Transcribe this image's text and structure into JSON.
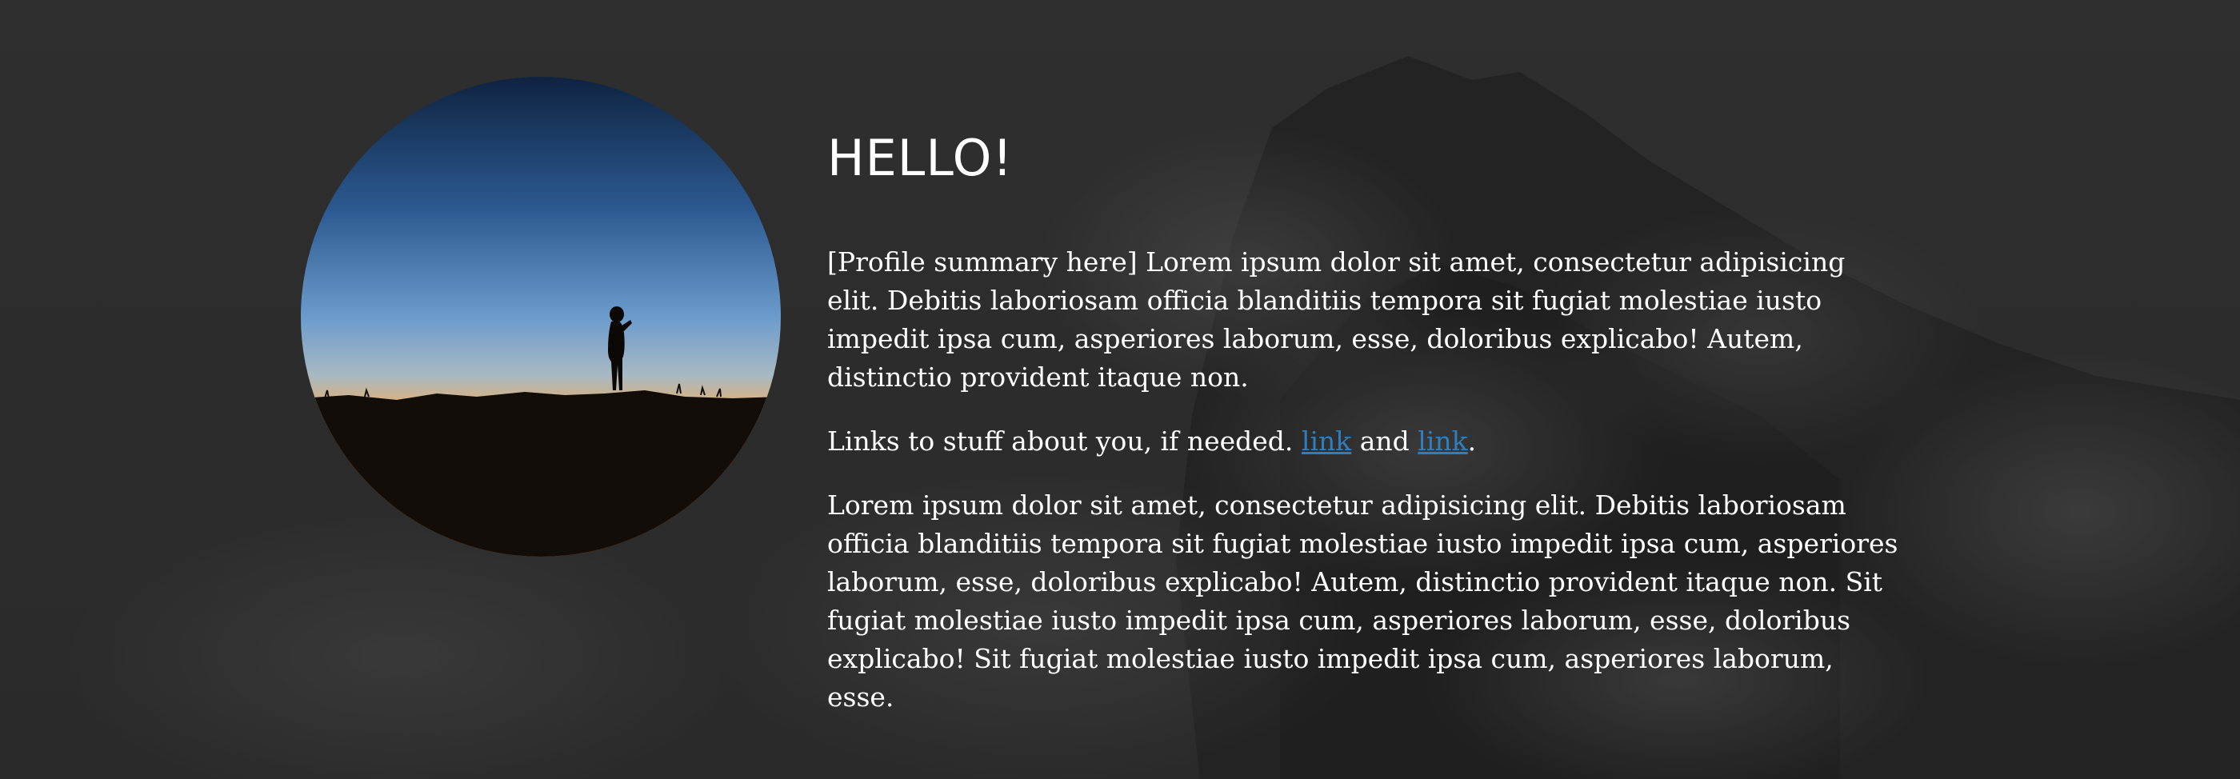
{
  "colors": {
    "background": "#2e2e2e",
    "text": "#ffffff",
    "link": "#2d7fbf",
    "sky_top": "#0f2340",
    "sky_mid": "#4a7fb8",
    "horizon": "#f39c3a",
    "ground": "#120d08"
  },
  "background": {
    "icon": "mountain-clouds-image"
  },
  "profile": {
    "icon": "sunset-silhouette-image"
  },
  "heading": "HELLO!",
  "summary": "[Profile summary here] Lorem ipsum dolor sit amet, consectetur adipisicing elit. Debitis laboriosam officia blanditiis tempora sit fugiat molestiae iusto impedit ipsa cum, asperiores laborum, esse, doloribus explicabo! Autem, distinctio provident itaque non.",
  "links_line": {
    "prefix": "Links to stuff about you, if needed. ",
    "link1": "link",
    "middle": " and ",
    "link2": "link",
    "suffix": "."
  },
  "body": "Lorem ipsum dolor sit amet, consectetur adipisicing elit. Debitis laboriosam officia blanditiis tempora sit fugiat molestiae iusto impedit ipsa cum, asperiores laborum, esse, doloribus explicabo! Autem, distinctio provident itaque non. Sit fugiat molestiae iusto impedit ipsa cum, asperiores laborum, esse, doloribus explicabo! Sit fugiat molestiae iusto impedit ipsa cum, asperiores laborum, esse."
}
